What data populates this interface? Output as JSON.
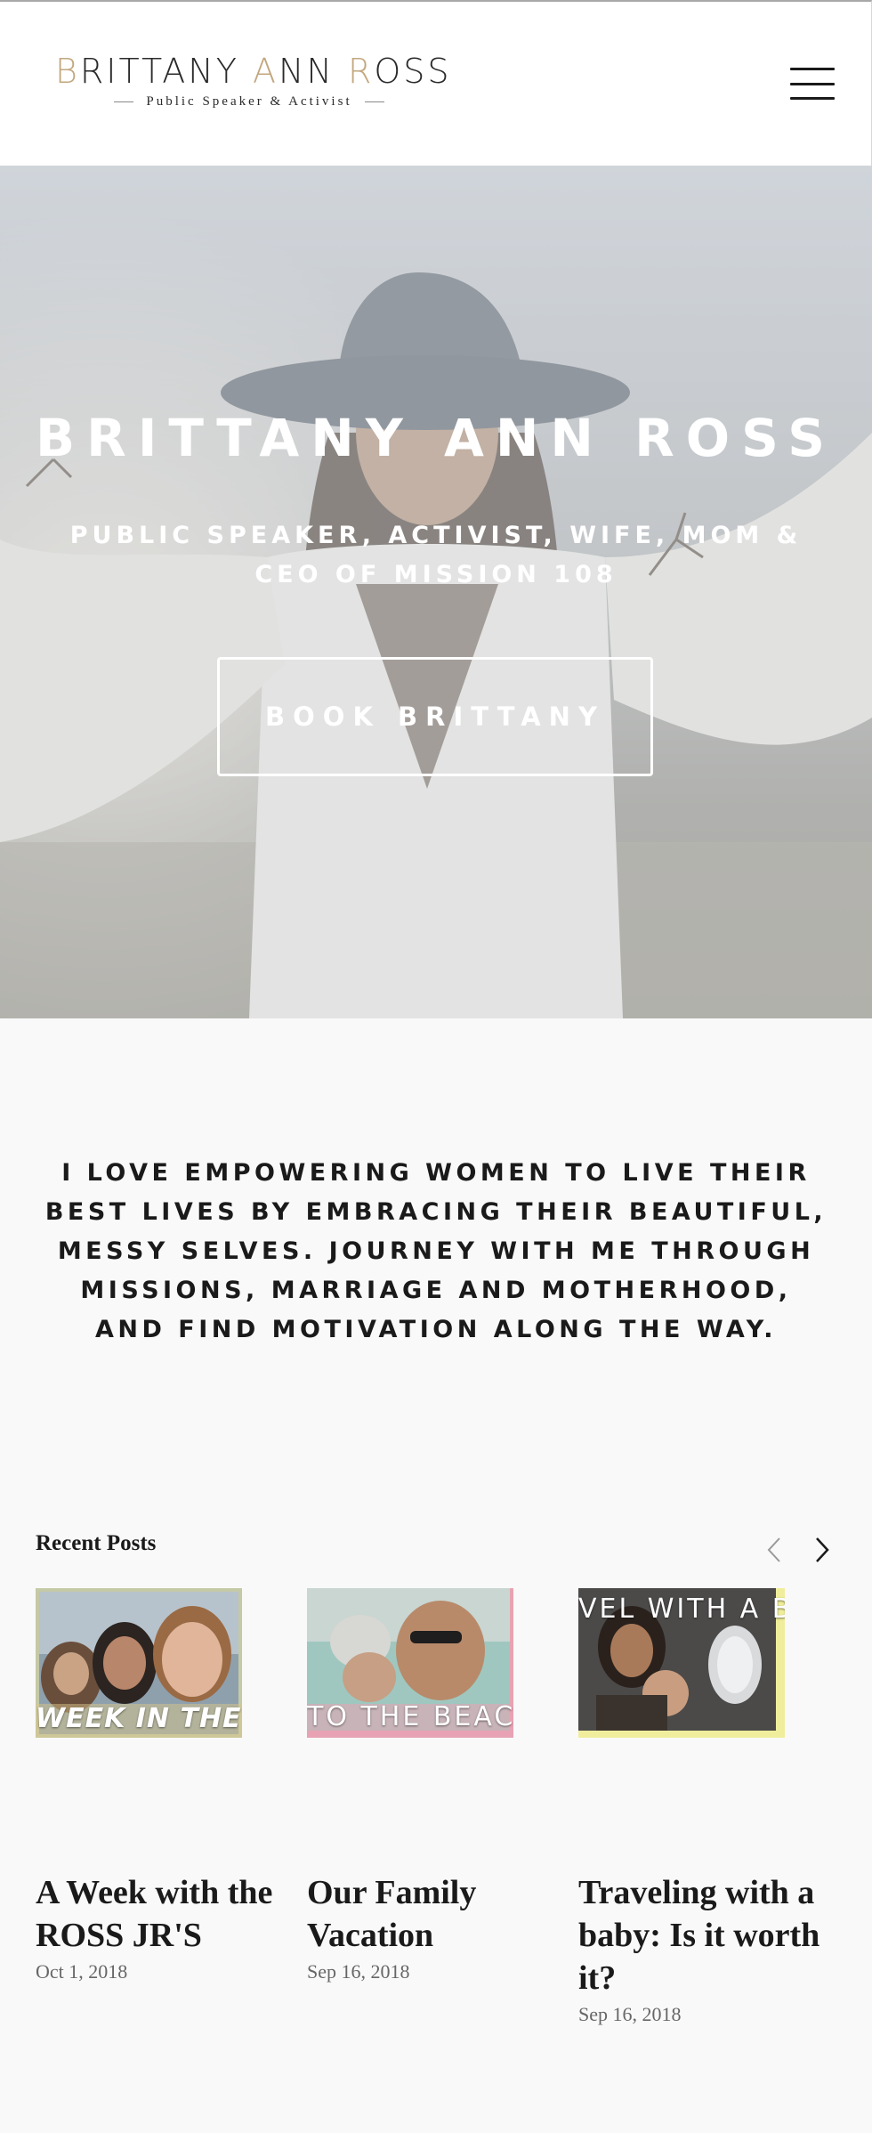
{
  "header": {
    "logo": {
      "name_parts": [
        "B",
        "RITTANY ",
        "A",
        "NN ",
        "R",
        "OSS"
      ],
      "tagline": "Public Speaker & Activist"
    },
    "menu_icon": "hamburger-menu-icon"
  },
  "hero": {
    "title": "BRITTANY ANN ROSS",
    "subtitle": "PUBLIC SPEAKER, ACTIVIST, WIFE, MOM & CEO OF MISSION 108",
    "button_label": "BOOK BRITTANY"
  },
  "intro": {
    "text": "I LOVE EMPOWERING WOMEN TO LIVE THEIR BEST LIVES BY EMBRACING THEIR BEAUTIFUL, MESSY SELVES. JOURNEY WITH ME THROUGH MISSIONS, MARRIAGE AND MOTHERHOOD, AND FIND MOTIVATION ALONG THE WAY."
  },
  "recent_posts": {
    "heading": "Recent Posts",
    "prev_icon": "chevron-left-icon",
    "next_icon": "chevron-right-icon",
    "posts": [
      {
        "title": "A Week with the ROSS JR'S",
        "date": "Oct 1, 2018",
        "thumb_caption": "WEEK IN THE LIFE"
      },
      {
        "title": "Our Family Vacation",
        "date": "Sep 16, 2018",
        "thumb_caption": "TO THE BEACH"
      },
      {
        "title": "Traveling with a baby: Is it worth it?",
        "date": "Sep 16, 2018",
        "thumb_caption": "VEL WITH A BABY"
      }
    ]
  },
  "colors": {
    "accent_gold": "#c2a77e",
    "text_dark": "#1a1a1a",
    "background": "#f9f9f9"
  }
}
